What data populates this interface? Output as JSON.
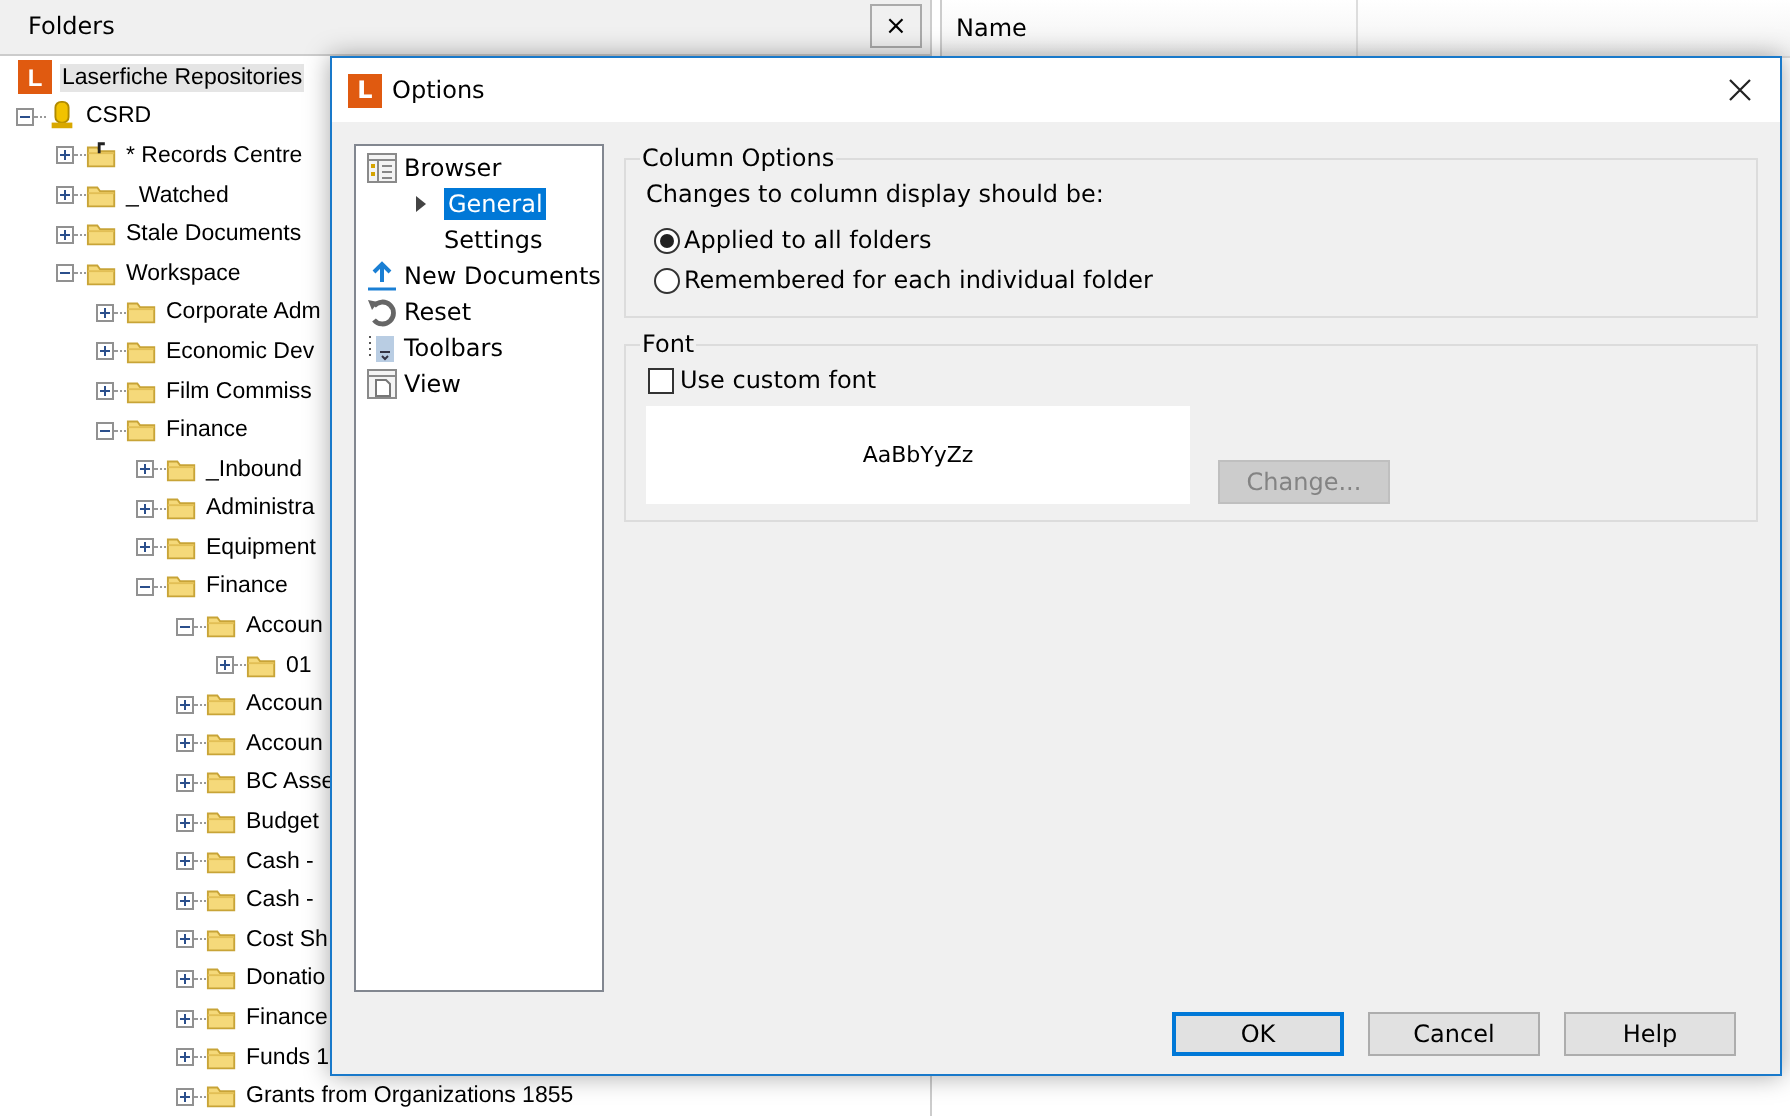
{
  "folders_pane": {
    "title": "Folders",
    "close": "×",
    "tree": [
      {
        "label": "Laserfiche Repositories",
        "kind": "repository",
        "logo": "L",
        "selected": true,
        "children": [
          {
            "label": "CSRD",
            "kind": "server",
            "expanded": true,
            "selected": false,
            "children": [
              {
                "label": "* Records Centre",
                "kind": "records",
                "expanded": false,
                "selected": false
              },
              {
                "label": "_Watched",
                "kind": "folder",
                "expanded": false,
                "selected": false
              },
              {
                "label": "Stale Documents",
                "kind": "folder",
                "expanded": false,
                "selected": false
              },
              {
                "label": "Workspace",
                "kind": "folder",
                "expanded": true,
                "selected": false,
                "children": [
                  {
                    "label": "Corporate Adm",
                    "kind": "folder",
                    "expanded": false,
                    "selected": false
                  },
                  {
                    "label": "Economic Dev",
                    "kind": "folder",
                    "expanded": false,
                    "selected": false
                  },
                  {
                    "label": "Film Commiss",
                    "kind": "folder",
                    "expanded": false,
                    "selected": false
                  },
                  {
                    "label": "Finance",
                    "kind": "folder",
                    "expanded": true,
                    "selected": false,
                    "children": [
                      {
                        "label": "_Inbound",
                        "kind": "folder",
                        "expanded": false,
                        "selected": false
                      },
                      {
                        "label": "Administra",
                        "kind": "folder",
                        "expanded": false,
                        "selected": false
                      },
                      {
                        "label": "Equipment",
                        "kind": "folder",
                        "expanded": false,
                        "selected": false
                      },
                      {
                        "label": "Finance",
                        "kind": "folder",
                        "expanded": true,
                        "selected": false,
                        "children": [
                          {
                            "label": "Accoun",
                            "kind": "folder",
                            "expanded": true,
                            "selected": false,
                            "children": [
                              {
                                "label": "01",
                                "kind": "folder",
                                "expanded": false,
                                "selected": false
                              }
                            ]
                          },
                          {
                            "label": "Accoun",
                            "kind": "folder",
                            "expanded": false,
                            "selected": false
                          },
                          {
                            "label": "Accoun",
                            "kind": "folder",
                            "expanded": false,
                            "selected": false
                          },
                          {
                            "label": "BC Asse",
                            "kind": "folder",
                            "expanded": false,
                            "selected": false
                          },
                          {
                            "label": "Budget",
                            "kind": "folder",
                            "expanded": false,
                            "selected": false
                          },
                          {
                            "label": "Cash -",
                            "kind": "folder",
                            "expanded": false,
                            "selected": false
                          },
                          {
                            "label": "Cash -",
                            "kind": "folder",
                            "expanded": false,
                            "selected": false
                          },
                          {
                            "label": "Cost Sh",
                            "kind": "folder",
                            "expanded": false,
                            "selected": false
                          },
                          {
                            "label": "Donatio",
                            "kind": "folder",
                            "expanded": false,
                            "selected": false
                          },
                          {
                            "label": "Finance",
                            "kind": "folder",
                            "expanded": false,
                            "selected": false
                          },
                          {
                            "label": "Funds 1",
                            "kind": "folder",
                            "expanded": false,
                            "selected": false
                          },
                          {
                            "label": "Grants from Organizations 1855",
                            "kind": "folder",
                            "expanded": false,
                            "selected": false
                          }
                        ]
                      }
                    ]
                  }
                ]
              }
            ]
          }
        ]
      }
    ]
  },
  "list_pane": {
    "columns": [
      "Name"
    ]
  },
  "dialog": {
    "logo": "L",
    "title": "Options",
    "nav": [
      {
        "label": "Browser",
        "kind": "browser",
        "selected": false,
        "children": [
          {
            "label": "General",
            "selected": true
          },
          {
            "label": "Settings",
            "selected": false
          }
        ]
      },
      {
        "label": "New Documents",
        "kind": "upload",
        "selected": false
      },
      {
        "label": "Reset",
        "kind": "reset",
        "selected": false
      },
      {
        "label": "Toolbars",
        "kind": "toolbars",
        "selected": false
      },
      {
        "label": "View",
        "kind": "view",
        "selected": false
      }
    ],
    "column_options": {
      "title": "Column Options",
      "prompt": "Changes to column display should be:",
      "options": [
        {
          "label": "Applied to all folders",
          "selected": true
        },
        {
          "label": "Remembered for each individual folder",
          "selected": false
        }
      ]
    },
    "font": {
      "title": "Font",
      "use_custom_font": {
        "label": "Use custom font",
        "checked": false
      },
      "preview": "AaBbYyZz",
      "change_button": {
        "label": "Change...",
        "disabled": true
      }
    },
    "buttons": [
      {
        "label": "OK",
        "default": true
      },
      {
        "label": "Cancel",
        "default": false
      },
      {
        "label": "Help",
        "default": false
      }
    ]
  }
}
